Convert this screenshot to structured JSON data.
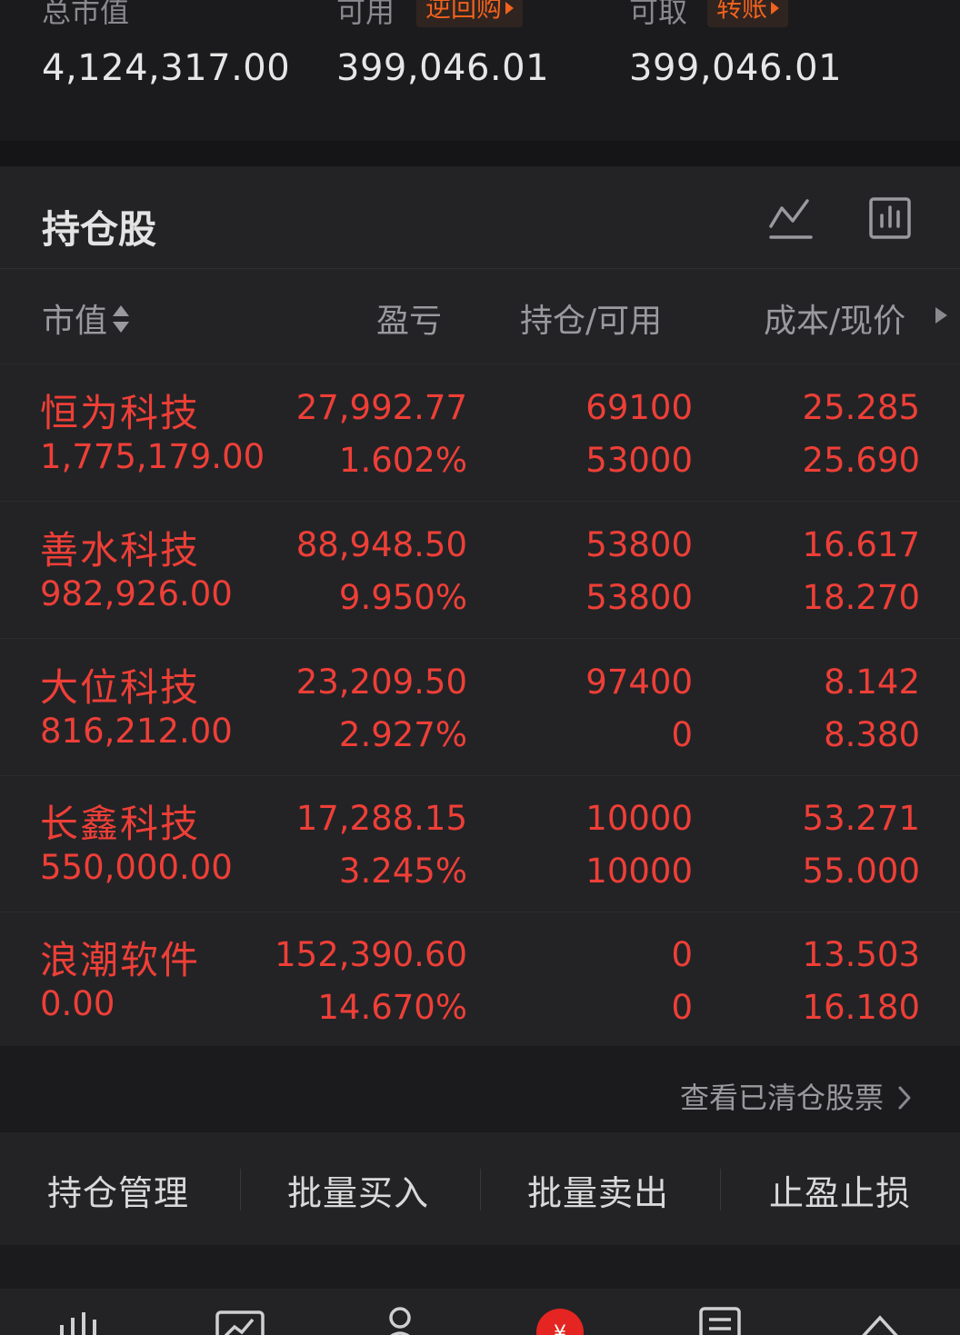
{
  "summary": {
    "total_market_value": {
      "label": "总市值",
      "value": "4,124,317.00"
    },
    "available": {
      "label": "可用",
      "action": "逆回购",
      "value": "399,046.01"
    },
    "withdrawable": {
      "label": "可取",
      "action": "转账",
      "value": "399,046.01"
    }
  },
  "holdings": {
    "title": "持仓股",
    "icons": [
      "line-chart-icon",
      "bar-chart-icon"
    ],
    "columns": {
      "market_value": "市值",
      "pnl": "盈亏",
      "position": "持仓/可用",
      "cost": "成本/现价"
    },
    "rows": [
      {
        "name": "恒为科技",
        "market_value": "1,775,179.00",
        "pnl": "27,992.77",
        "pnl_pct": "1.602%",
        "holding": "69100",
        "available": "53000",
        "cost": "25.285",
        "price": "25.690"
      },
      {
        "name": "善水科技",
        "market_value": "982,926.00",
        "pnl": "88,948.50",
        "pnl_pct": "9.950%",
        "holding": "53800",
        "available": "53800",
        "cost": "16.617",
        "price": "18.270"
      },
      {
        "name": "大位科技",
        "market_value": "816,212.00",
        "pnl": "23,209.50",
        "pnl_pct": "2.927%",
        "holding": "97400",
        "available": "0",
        "cost": "8.142",
        "price": "8.380"
      },
      {
        "name": "长鑫科技",
        "market_value": "550,000.00",
        "pnl": "17,288.15",
        "pnl_pct": "3.245%",
        "holding": "10000",
        "available": "10000",
        "cost": "53.271",
        "price": "55.000"
      },
      {
        "name": "浪潮软件",
        "market_value": "0.00",
        "pnl": "152,390.60",
        "pnl_pct": "14.670%",
        "holding": "0",
        "available": "0",
        "cost": "13.503",
        "price": "16.180"
      }
    ],
    "cleared_link": "查看已清仓股票"
  },
  "actions": [
    "持仓管理",
    "批量买入",
    "批量卖出",
    "止盈止损"
  ],
  "bottom_nav": [
    "market-icon",
    "chart-icon",
    "profile-icon",
    "trade-icon",
    "news-icon",
    "more-icon"
  ],
  "colors": {
    "up_red": "#ee3f37",
    "accent_orange": "#f0621d",
    "background": "#1b1b1d"
  }
}
